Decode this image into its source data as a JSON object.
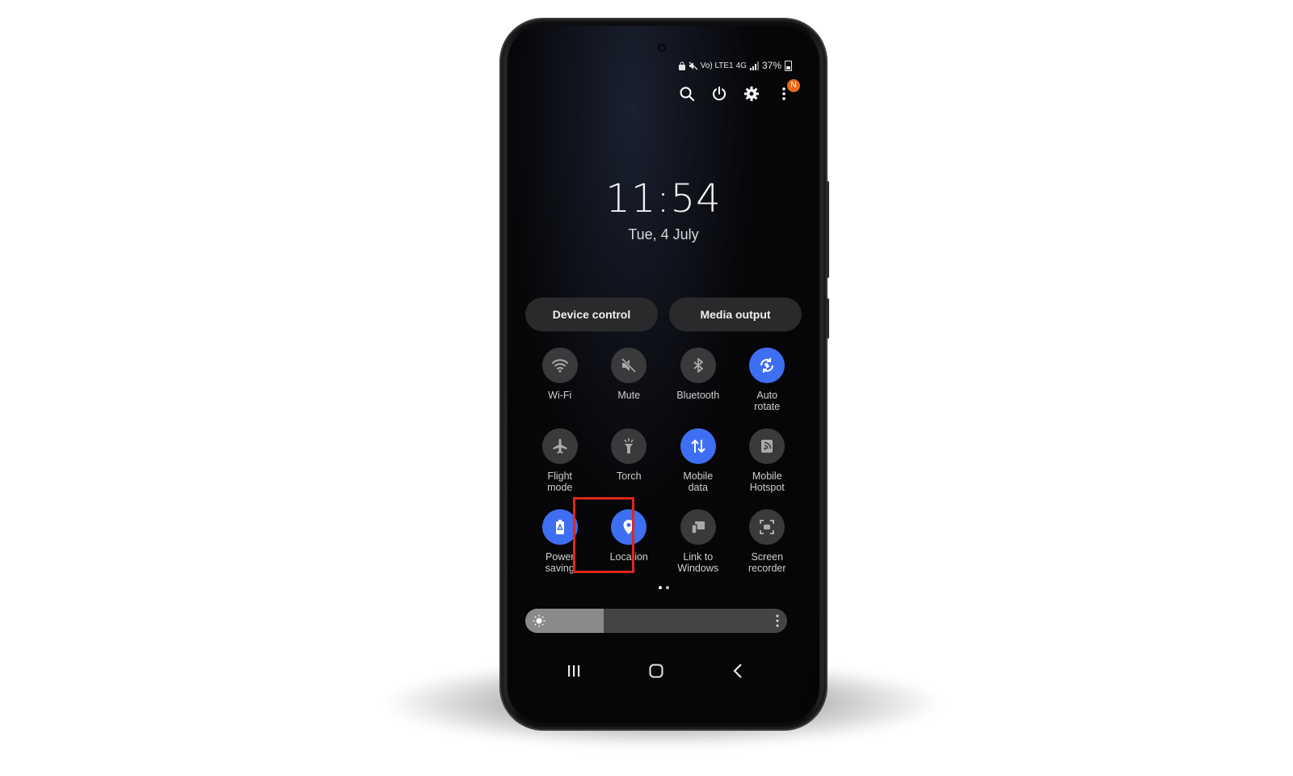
{
  "status_bar": {
    "battery_percent": "37%",
    "network": "4G",
    "carrier_label": "Vo) LTE1"
  },
  "notification_badge": "N",
  "clock": {
    "time": "11:54",
    "date": "Tue, 4 July"
  },
  "buttons": {
    "device_control": "Device control",
    "media_output": "Media output"
  },
  "tiles": [
    {
      "label": "Wi-Fi",
      "icon": "wifi-icon",
      "on": false
    },
    {
      "label": "Mute",
      "icon": "mute-icon",
      "on": false
    },
    {
      "label": "Bluetooth",
      "icon": "bluetooth-icon",
      "on": false
    },
    {
      "label": "Auto\nrotate",
      "icon": "auto-rotate-icon",
      "on": true
    },
    {
      "label": "Flight\nmode",
      "icon": "airplane-icon",
      "on": false
    },
    {
      "label": "Torch",
      "icon": "torch-icon",
      "on": false
    },
    {
      "label": "Mobile\ndata",
      "icon": "mobile-data-icon",
      "on": true
    },
    {
      "label": "Mobile\nHotspot",
      "icon": "hotspot-icon",
      "on": false
    },
    {
      "label": "Power\nsaving",
      "icon": "power-saving-icon",
      "on": true
    },
    {
      "label": "Location",
      "icon": "location-icon",
      "on": true
    },
    {
      "label": "Link to\nWindows",
      "icon": "link-to-windows-icon",
      "on": false
    },
    {
      "label": "Screen\nrecorder",
      "icon": "screen-recorder-icon",
      "on": false
    }
  ],
  "brightness": {
    "level": 0.3
  },
  "page_indicator": {
    "count": 2,
    "active": 0
  },
  "colors": {
    "accent": "#3e6ff3",
    "highlight_box": "#e0261c",
    "badge": "#ea6a1a"
  }
}
